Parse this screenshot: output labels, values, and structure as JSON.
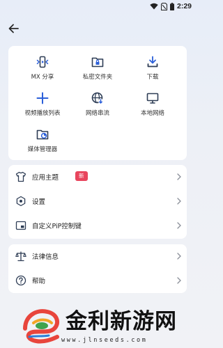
{
  "status_bar": {
    "time": "2:29",
    "icons": [
      "wifi-icon",
      "sim-icon",
      "battery-icon"
    ]
  },
  "header": {
    "back_icon": "arrow-left-icon"
  },
  "grid": {
    "items": [
      {
        "label": "MX 分享",
        "icon": "share-icon"
      },
      {
        "label": "私密文件夹",
        "icon": "lock-folder-icon"
      },
      {
        "label": "下载",
        "icon": "download-icon"
      },
      {
        "label": "视频播放列表",
        "icon": "plus-icon"
      },
      {
        "label": "网络串流",
        "icon": "globe-stream-icon"
      },
      {
        "label": "本地网络",
        "icon": "monitor-icon"
      },
      {
        "label": "媒体管理器",
        "icon": "media-folder-icon"
      }
    ]
  },
  "settings_group": {
    "items": [
      {
        "label": "应用主题",
        "badge": "新",
        "icon": "shirt-icon"
      },
      {
        "label": "设置",
        "icon": "settings-icon"
      },
      {
        "label": "自定义PiP控制键",
        "icon": "pip-icon"
      }
    ]
  },
  "info_group": {
    "items": [
      {
        "label": "法律信息",
        "icon": "scale-icon"
      },
      {
        "label": "帮助",
        "icon": "help-icon"
      }
    ]
  },
  "watermark": {
    "text": "金利新游网",
    "url": "www.jlnseeds.com"
  },
  "colors": {
    "accent": "#2b5fd9",
    "badge": "#e8455d",
    "icon": "#2e3d55"
  }
}
